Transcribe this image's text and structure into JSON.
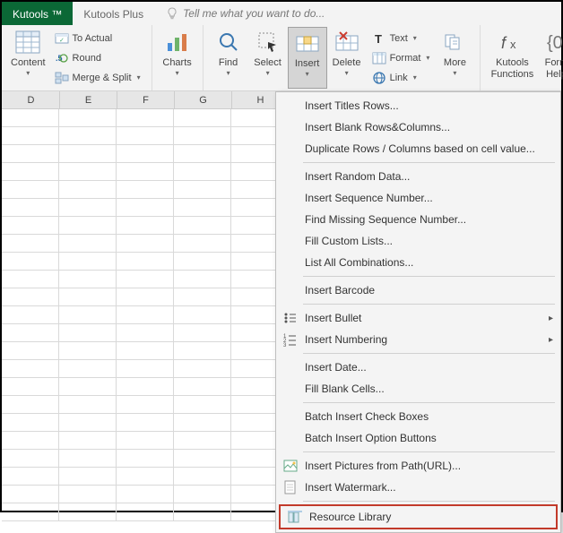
{
  "tabs": {
    "kutools": "Kutools ™",
    "kutools_plus": "Kutools Plus",
    "tell_me": "Tell me what you want to do..."
  },
  "ribbon": {
    "content": "Content",
    "to_actual": "To Actual",
    "round": "Round",
    "merge_split": "Merge & Split",
    "charts": "Charts",
    "find": "Find",
    "select": "Select",
    "insert": "Insert",
    "delete": "Delete",
    "text": "Text",
    "format": "Format",
    "link": "Link",
    "more": "More",
    "kutools_functions": "Kutools\nFunctions",
    "formula_helper": "Form\nHelp"
  },
  "columns": [
    "D",
    "E",
    "F",
    "G",
    "H"
  ],
  "menu": {
    "titles_rows": "Insert Titles Rows...",
    "blank_rc": "Insert Blank Rows&Columns...",
    "dup_rows": "Duplicate Rows / Columns based on cell value...",
    "random": "Insert Random Data...",
    "seq": "Insert Sequence Number...",
    "find_missing": "Find Missing Sequence Number...",
    "fill_custom": "Fill Custom Lists...",
    "list_comb": "List All Combinations...",
    "barcode": "Insert Barcode",
    "bullet": "Insert Bullet",
    "numbering": "Insert Numbering",
    "date": "Insert Date...",
    "fill_blank": "Fill Blank Cells...",
    "check_boxes": "Batch Insert Check Boxes",
    "option_btns": "Batch Insert Option Buttons",
    "pictures_url": "Insert Pictures from Path(URL)...",
    "watermark": "Insert Watermark...",
    "resource_lib": "Resource Library"
  }
}
